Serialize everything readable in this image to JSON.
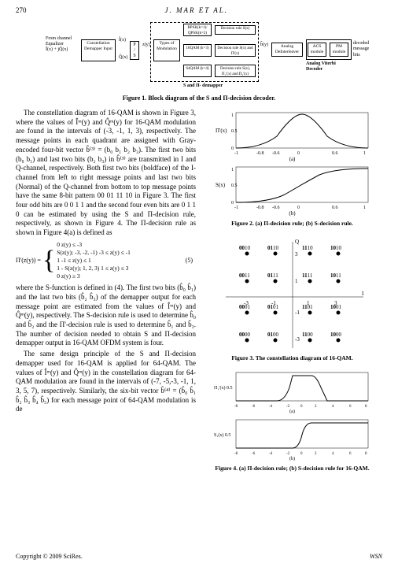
{
  "page_number": "270",
  "header_author": "J. MAR  ET  AL.",
  "block_diagram": {
    "left_label": "From channel\nEqualizer",
    "input_sym": "Ĩ(x) + jQ̃(x)",
    "box_constellation": "Constellation\nDemapper\nInput",
    "ix": "Î(x)",
    "qx": "Q̂(x)",
    "ps": "P / S",
    "zy": "z(y)",
    "box_types": "Types of\nModulation",
    "mod_bpsk": "BPSK(k=1)/\nQPSK(k=2)",
    "mod_16": "16QAM\n(k=3)",
    "mod_64": "64QAM\n(k=4)",
    "rule1": "Decision rule S(x)",
    "rule2": "Decision rule S(x) and\nΠ'(x)",
    "rule3": "Decision rule  S(x), Π₁'(x)\nand Π₂'(x)",
    "b_hat": "b̂(y)",
    "box_deint": "Analog\nDeInterleaver",
    "box_acs": "ACS\nmodule",
    "box_pm": "PM\nmodule",
    "out_label": "decoded\nmessage\nbits",
    "s_pi_label": "S and Π- demapper",
    "viterbi_label": "Analog Viterbi Decoder"
  },
  "fig1_caption": "Figure 1. Block diagram of the S and Π-decision decoder.",
  "body_text": {
    "p1": "The constellation diagram of 16-QAM is shown in Figure 3, where the values of Îᵐ(y) and Q̂ᵐ(y) for 16-QAM modulation are found in the intervals of (-3, -1, 1, 3), respectively. The message points in each quadrant are assigned with Gray-encoded four-bit vector b̂⁽³⁾ = (b₀ b₁ b₂ b₃). The first two bits (b₀ b₁) and last two bits (b₂ b₃) in b̂⁽³⁾ are transmitted in I and Q-channel, respectively. Both first two bits (boldface) of the I-channel from left to right message points and last two bits (Normal) of the Q-channel from bottom to top message points have the same 8-bit pattern 00 01 11 10 in Figure 3. The first four odd bits are 0 0 1 1 and the second four even bits are 0 1 1 0 can be estimated by using the S and Π-decision rule, respectively, as shown in Figure 4. The Π-decision rule as shown in Figure 4(a) is defined as",
    "p2": "where the S-function is defined in (4). The first two bits (b̂₀  b̂₁) and the last two bits (b̂₂  b̂₃) of the demapper output for each message point are estimated from the values of Îᵐ(y) and Q̂ᵐ(y), respectively. The S-decision rule is used to determine b̂₀ and b̂₂ and the Π'-decision rule is used to determine b̂₁ and b̂₃. The number of decision needed to obtain S and Π-decision demapper output in 16-QAM OFDM system is four.",
    "p3": "The same design principle of the S and Π-decision demapper used for 16-QAM is applied for 64-QAM. The values of Îᵐ(y) and Q̂ᵐ(y) in the constellation diagram for 64-QAM modulation are found in the intervals of (-7, -5,-3, -1, 1, 3, 5, 7), respectively. Similarly, the six-bit vector b̂⁽⁴⁾ = (b̂₀  b̂₁  b̂₂  b̂₃  b̂₄  b̂₅) for each message point of 64-QAM modulation is de"
  },
  "eq5": {
    "lhs": "Π'(z(y)) =",
    "row1": "0                          z(y) ≤ -3",
    "row2": "S(z(y); -3, -2, -1)   -3 ≤ z(y) ≤ -1",
    "row3": "1                     -1 ≤ z(y) ≤ 1",
    "row4": "1 - S(z(y); 1, 2, 3)   1 ≤ z(y) ≤ 3",
    "row5": "0                          z(y) ≥ 3",
    "num": "(5)"
  },
  "fig2_caption": "Figure 2. (a) Π-decision rule; (b) S-decision rule.",
  "fig3_caption": "Figure 3. The constellation diagram of 16-QAM.",
  "fig4_caption": "Figure 4. (a) Π-decision rule; (b) S-decision rule for 16-QAM.",
  "constellation_labels": {
    "q_axis": "Q",
    "i_axis": "I",
    "tick_3": "3",
    "tick_1": "1",
    "tick_n1": "-1",
    "tick_n3": "-3",
    "r0": [
      "0010",
      "0110",
      "1110",
      "1010"
    ],
    "r1": [
      "0011",
      "0111",
      "1111",
      "1011"
    ],
    "r2": [
      "0001",
      "0101",
      "1101",
      "1001"
    ],
    "r3": [
      "0000",
      "0100",
      "1100",
      "1000"
    ]
  },
  "axis_labels": {
    "pi_x": "Π'(x)",
    "s_x": "S(x)",
    "a_label": "(a)",
    "b_label": "(b)",
    "pi1": "Π₁'(x) 0.5",
    "s1": "S₁(x) 0.5"
  },
  "chart_data": [
    {
      "type": "line",
      "name": "Figure 2a Pi-decision",
      "xlabel": "",
      "ylabel": "Π'(x)",
      "x": [
        -1,
        -0.8,
        -0.6,
        -0.4,
        -0.2,
        0,
        0.2,
        0.4,
        0.6,
        0.8,
        1
      ],
      "values": [
        0,
        0.05,
        0.2,
        0.5,
        0.85,
        1,
        0.85,
        0.5,
        0.2,
        0.05,
        0
      ],
      "xlim": [
        -1,
        1
      ],
      "ylim": [
        0,
        1
      ]
    },
    {
      "type": "line",
      "name": "Figure 2b S-decision",
      "xlabel": "",
      "ylabel": "S(x)",
      "x": [
        -1,
        -0.8,
        -0.6,
        -0.4,
        -0.2,
        0,
        0.2,
        0.4,
        0.6,
        0.8,
        1
      ],
      "values": [
        0,
        0.03,
        0.1,
        0.25,
        0.4,
        0.5,
        0.6,
        0.75,
        0.9,
        0.97,
        1
      ],
      "xlim": [
        -1,
        1
      ],
      "ylim": [
        0,
        1
      ]
    },
    {
      "type": "scatter",
      "name": "Figure 3 16-QAM constellation",
      "xlabel": "I",
      "ylabel": "Q",
      "points": [
        {
          "x": -3,
          "y": 3,
          "label": "0010"
        },
        {
          "x": -1,
          "y": 3,
          "label": "0110"
        },
        {
          "x": 1,
          "y": 3,
          "label": "1110"
        },
        {
          "x": 3,
          "y": 3,
          "label": "1010"
        },
        {
          "x": -3,
          "y": 1,
          "label": "0011"
        },
        {
          "x": -1,
          "y": 1,
          "label": "0111"
        },
        {
          "x": 1,
          "y": 1,
          "label": "1111"
        },
        {
          "x": 3,
          "y": 1,
          "label": "1011"
        },
        {
          "x": -3,
          "y": -1,
          "label": "0001"
        },
        {
          "x": -1,
          "y": -1,
          "label": "0101"
        },
        {
          "x": 1,
          "y": -1,
          "label": "1101"
        },
        {
          "x": 3,
          "y": -1,
          "label": "1001"
        },
        {
          "x": -3,
          "y": -3,
          "label": "0000"
        },
        {
          "x": -1,
          "y": -3,
          "label": "0100"
        },
        {
          "x": 1,
          "y": -3,
          "label": "1100"
        },
        {
          "x": 3,
          "y": -3,
          "label": "1000"
        }
      ],
      "xlim": [
        -4,
        4
      ],
      "ylim": [
        -4,
        4
      ]
    },
    {
      "type": "line",
      "name": "Figure 4a Pi-decision 16-QAM",
      "xlabel": "",
      "ylabel": "Π₁'(x)",
      "x": [
        -8,
        -6,
        -4,
        -3,
        -2,
        -1,
        0,
        1,
        2,
        3,
        4,
        6,
        8
      ],
      "values": [
        0,
        0,
        0,
        0,
        0.5,
        1,
        1,
        1,
        0.5,
        0,
        0,
        0,
        0
      ],
      "xlim": [
        -8,
        8
      ],
      "ylim": [
        0,
        1
      ]
    },
    {
      "type": "line",
      "name": "Figure 4b S-decision 16-QAM",
      "xlabel": "",
      "ylabel": "S₁(x)",
      "x": [
        -8,
        -6,
        -4,
        -2,
        -1,
        0,
        1,
        2,
        4,
        6,
        8
      ],
      "values": [
        0,
        0,
        0,
        0,
        0.1,
        0.5,
        0.9,
        1,
        1,
        1,
        1
      ],
      "xlim": [
        -8,
        8
      ],
      "ylim": [
        0,
        1
      ]
    }
  ],
  "copyright": "Copyright © 2009 SciRes.",
  "journal": "WSN"
}
